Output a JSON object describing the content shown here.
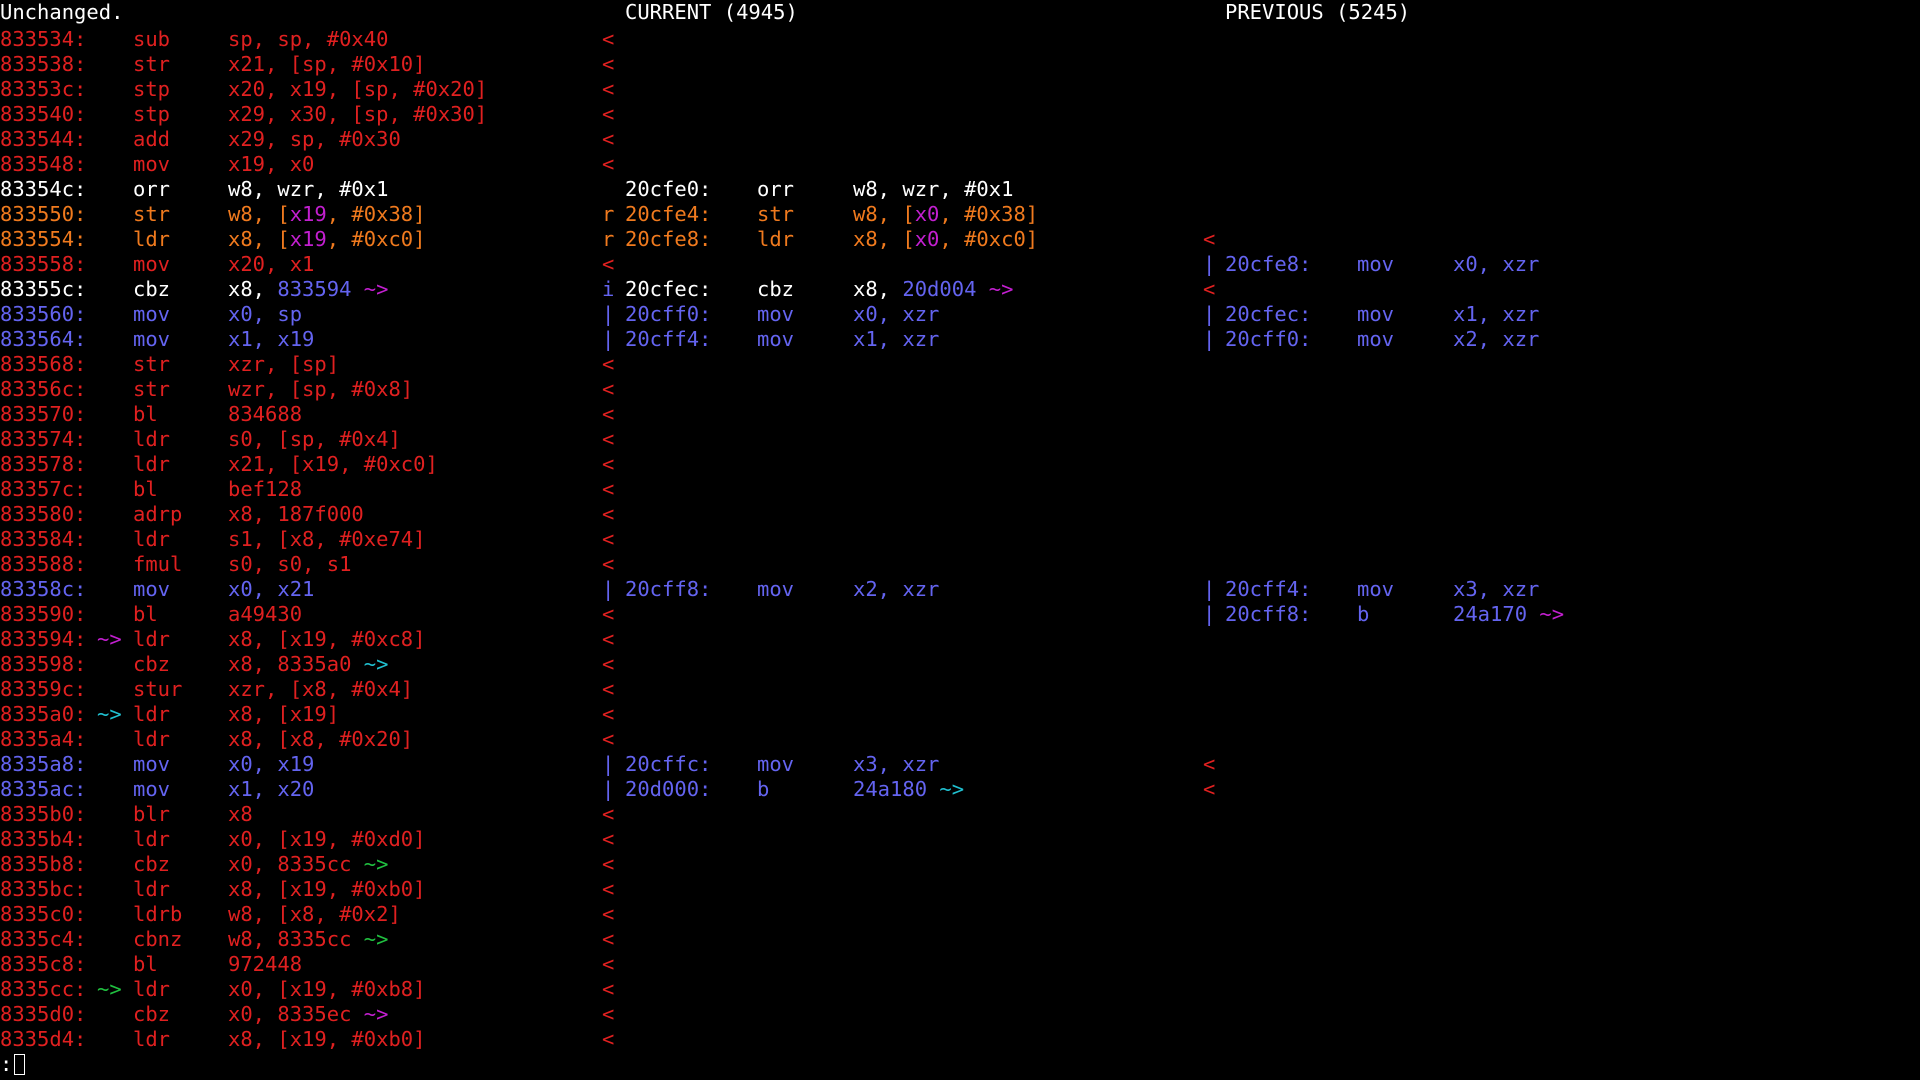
{
  "header": {
    "status": "Unchanged.",
    "current_label": "CURRENT (4945)",
    "previous_label": "PREVIOUS (5245)"
  },
  "prompt": ":",
  "colors": {
    "removed": "#e02020",
    "same": "#ffffff",
    "changed": "#f07a1e",
    "inserted": "#6464f0",
    "register_highlight": "#c31fd0",
    "magenta_arrow": "#c31fd0",
    "cyan_arrow": "#20c0d0",
    "green_arrow": "#20c040"
  },
  "rows": [
    {
      "left": {
        "t": "r",
        "addr": "833534:",
        "op": "sub",
        "args": [
          [
            "sp, sp, #0x40"
          ]
        ]
      },
      "cm": "<"
    },
    {
      "left": {
        "t": "r",
        "addr": "833538:",
        "op": "str",
        "args": [
          [
            "x21, [sp, #0x10]"
          ]
        ]
      },
      "cm": "<"
    },
    {
      "left": {
        "t": "r",
        "addr": "83353c:",
        "op": "stp",
        "args": [
          [
            "x20, x19, [sp, #0x20]"
          ]
        ]
      },
      "cm": "<"
    },
    {
      "left": {
        "t": "r",
        "addr": "833540:",
        "op": "stp",
        "args": [
          [
            "x29, x30, [sp, #0x30]"
          ]
        ]
      },
      "cm": "<"
    },
    {
      "left": {
        "t": "r",
        "addr": "833544:",
        "op": "add",
        "args": [
          [
            "x29, sp, #0x30"
          ]
        ]
      },
      "cm": "<"
    },
    {
      "left": {
        "t": "r",
        "addr": "833548:",
        "op": "mov",
        "args": [
          [
            "x19, x0"
          ]
        ]
      },
      "cm": "<"
    },
    {
      "left": {
        "t": "w",
        "addr": "83354c:",
        "op": "orr",
        "args": [
          [
            "w8, wzr, #0x1"
          ]
        ]
      },
      "cur": {
        "t": "w",
        "addr": "20cfe0:",
        "op": "orr",
        "args": [
          [
            "w8, wzr, #0x1"
          ]
        ]
      }
    },
    {
      "left": {
        "t": "o",
        "addr": "833550:",
        "op": "str",
        "args": [
          [
            "w8, ["
          ],
          [
            "x19",
            "m"
          ],
          [
            ", #0x38]"
          ]
        ]
      },
      "cm": "r",
      "cur": {
        "t": "o",
        "addr": "20cfe4:",
        "op": "str",
        "args": [
          [
            "w8, ["
          ],
          [
            "x0",
            "m"
          ],
          [
            ", #0x38]"
          ]
        ]
      }
    },
    {
      "left": {
        "t": "o",
        "addr": "833554:",
        "op": "ldr",
        "args": [
          [
            "x8, ["
          ],
          [
            "x19",
            "m"
          ],
          [
            ", #0xc0]"
          ]
        ]
      },
      "cm": "r",
      "cur": {
        "t": "o",
        "addr": "20cfe8:",
        "op": "ldr",
        "args": [
          [
            "x8, ["
          ],
          [
            "x0",
            "m"
          ],
          [
            ", #0xc0]"
          ]
        ]
      },
      "pm": "<"
    },
    {
      "left": {
        "t": "r",
        "addr": "833558:",
        "op": "mov",
        "args": [
          [
            "x20, x1"
          ]
        ]
      },
      "cm": "<",
      "prev": {
        "t": "b",
        "addr": "20cfe8:",
        "op": "mov",
        "args": [
          [
            "x0, xzr"
          ]
        ]
      },
      "pm": "|"
    },
    {
      "left": {
        "t": "w",
        "addr": "83355c:",
        "op": "cbz",
        "args": [
          [
            "x8, "
          ],
          [
            "833594",
            "b"
          ],
          [
            " ~>",
            "m"
          ]
        ]
      },
      "cm": "i",
      "cur": {
        "t": "w",
        "addr": "20cfec:",
        "op": "cbz",
        "args": [
          [
            "x8, "
          ],
          [
            "20d004",
            "b"
          ],
          [
            " ~>",
            "m"
          ]
        ]
      },
      "pm": "<"
    },
    {
      "left": {
        "t": "b",
        "addr": "833560:",
        "op": "mov",
        "args": [
          [
            "x0, sp"
          ]
        ]
      },
      "cm": "|",
      "cur": {
        "t": "b",
        "addr": "20cff0:",
        "op": "mov",
        "args": [
          [
            "x0, xzr"
          ]
        ]
      },
      "prev": {
        "t": "b",
        "addr": "20cfec:",
        "op": "mov",
        "args": [
          [
            "x1, xzr"
          ]
        ]
      },
      "pm": "|"
    },
    {
      "left": {
        "t": "b",
        "addr": "833564:",
        "op": "mov",
        "args": [
          [
            "x1, x19"
          ]
        ]
      },
      "cm": "|",
      "cur": {
        "t": "b",
        "addr": "20cff4:",
        "op": "mov",
        "args": [
          [
            "x1, xzr"
          ]
        ]
      },
      "prev": {
        "t": "b",
        "addr": "20cff0:",
        "op": "mov",
        "args": [
          [
            "x2, xzr"
          ]
        ]
      },
      "pm": "|"
    },
    {
      "left": {
        "t": "r",
        "addr": "833568:",
        "op": "str",
        "args": [
          [
            "xzr, [sp]"
          ]
        ]
      },
      "cm": "<"
    },
    {
      "left": {
        "t": "r",
        "addr": "83356c:",
        "op": "str",
        "args": [
          [
            "wzr, [sp, #0x8]"
          ]
        ]
      },
      "cm": "<"
    },
    {
      "left": {
        "t": "r",
        "addr": "833570:",
        "op": "bl",
        "args": [
          [
            "834688"
          ]
        ]
      },
      "cm": "<"
    },
    {
      "left": {
        "t": "r",
        "addr": "833574:",
        "op": "ldr",
        "args": [
          [
            "s0, [sp, #0x4]"
          ]
        ]
      },
      "cm": "<"
    },
    {
      "left": {
        "t": "r",
        "addr": "833578:",
        "op": "ldr",
        "args": [
          [
            "x21, [x19, #0xc0]"
          ]
        ]
      },
      "cm": "<"
    },
    {
      "left": {
        "t": "r",
        "addr": "83357c:",
        "op": "bl",
        "args": [
          [
            "bef128"
          ]
        ]
      },
      "cm": "<"
    },
    {
      "left": {
        "t": "r",
        "addr": "833580:",
        "op": "adrp",
        "args": [
          [
            "x8, 187f000"
          ]
        ]
      },
      "cm": "<"
    },
    {
      "left": {
        "t": "r",
        "addr": "833584:",
        "op": "ldr",
        "args": [
          [
            "s1, [x8, #0xe74]"
          ]
        ]
      },
      "cm": "<"
    },
    {
      "left": {
        "t": "r",
        "addr": "833588:",
        "op": "fmul",
        "args": [
          [
            "s0, s0, s1"
          ]
        ]
      },
      "cm": "<"
    },
    {
      "left": {
        "t": "b",
        "addr": "83358c:",
        "op": "mov",
        "args": [
          [
            "x0, x21"
          ]
        ]
      },
      "cm": "|",
      "cur": {
        "t": "b",
        "addr": "20cff8:",
        "op": "mov",
        "args": [
          [
            "x2, xzr"
          ]
        ]
      },
      "prev": {
        "t": "b",
        "addr": "20cff4:",
        "op": "mov",
        "args": [
          [
            "x3, xzr"
          ]
        ]
      },
      "pm": "|"
    },
    {
      "left": {
        "t": "r",
        "addr": "833590:",
        "op": "bl",
        "args": [
          [
            "a49430"
          ]
        ]
      },
      "cm": "<",
      "prev": {
        "t": "b",
        "addr": "20cff8:",
        "op": "b",
        "args": [
          [
            "24a170"
          ],
          [
            " ~>",
            "m"
          ]
        ]
      },
      "pm": "|"
    },
    {
      "left": {
        "t": "r",
        "addr": "833594:",
        "arrow": [
          "~>",
          "m"
        ],
        "op": "ldr",
        "args": [
          [
            "x8, [x19, #0xc8]"
          ]
        ]
      },
      "cm": "<"
    },
    {
      "left": {
        "t": "r",
        "addr": "833598:",
        "op": "cbz",
        "args": [
          [
            "x8, 8335a0"
          ],
          [
            " ~>",
            "c"
          ]
        ]
      },
      "cm": "<"
    },
    {
      "left": {
        "t": "r",
        "addr": "83359c:",
        "op": "stur",
        "args": [
          [
            "xzr, [x8, #0x4]"
          ]
        ]
      },
      "cm": "<"
    },
    {
      "left": {
        "t": "r",
        "addr": "8335a0:",
        "arrow": [
          "~>",
          "c"
        ],
        "op": "ldr",
        "args": [
          [
            "x8, [x19]"
          ]
        ]
      },
      "cm": "<"
    },
    {
      "left": {
        "t": "r",
        "addr": "8335a4:",
        "op": "ldr",
        "args": [
          [
            "x8, [x8, #0x20]"
          ]
        ]
      },
      "cm": "<"
    },
    {
      "left": {
        "t": "b",
        "addr": "8335a8:",
        "op": "mov",
        "args": [
          [
            "x0, x19"
          ]
        ]
      },
      "cm": "|",
      "cur": {
        "t": "b",
        "addr": "20cffc:",
        "op": "mov",
        "args": [
          [
            "x3, xzr"
          ]
        ]
      },
      "pm": "<"
    },
    {
      "left": {
        "t": "b",
        "addr": "8335ac:",
        "op": "mov",
        "args": [
          [
            "x1, x20"
          ]
        ]
      },
      "cm": "|",
      "cur": {
        "t": "b",
        "addr": "20d000:",
        "op": "b",
        "args": [
          [
            "24a180"
          ],
          [
            " ~>",
            "c"
          ]
        ]
      },
      "pm": "<"
    },
    {
      "left": {
        "t": "r",
        "addr": "8335b0:",
        "op": "blr",
        "args": [
          [
            "x8"
          ]
        ]
      },
      "cm": "<"
    },
    {
      "left": {
        "t": "r",
        "addr": "8335b4:",
        "op": "ldr",
        "args": [
          [
            "x0, [x19, #0xd0]"
          ]
        ]
      },
      "cm": "<"
    },
    {
      "left": {
        "t": "r",
        "addr": "8335b8:",
        "op": "cbz",
        "args": [
          [
            "x0, 8335cc"
          ],
          [
            " ~>",
            "g"
          ]
        ]
      },
      "cm": "<"
    },
    {
      "left": {
        "t": "r",
        "addr": "8335bc:",
        "op": "ldr",
        "args": [
          [
            "x8, [x19, #0xb0]"
          ]
        ]
      },
      "cm": "<"
    },
    {
      "left": {
        "t": "r",
        "addr": "8335c0:",
        "op": "ldrb",
        "args": [
          [
            "w8, [x8, #0x2]"
          ]
        ]
      },
      "cm": "<"
    },
    {
      "left": {
        "t": "r",
        "addr": "8335c4:",
        "op": "cbnz",
        "args": [
          [
            "w8, 8335cc"
          ],
          [
            " ~>",
            "g"
          ]
        ]
      },
      "cm": "<"
    },
    {
      "left": {
        "t": "r",
        "addr": "8335c8:",
        "op": "bl",
        "args": [
          [
            "972448"
          ]
        ]
      },
      "cm": "<"
    },
    {
      "left": {
        "t": "r",
        "addr": "8335cc:",
        "arrow": [
          "~>",
          "g"
        ],
        "op": "ldr",
        "args": [
          [
            "x0, [x19, #0xb8]"
          ]
        ]
      },
      "cm": "<"
    },
    {
      "left": {
        "t": "r",
        "addr": "8335d0:",
        "op": "cbz",
        "args": [
          [
            "x0, 8335ec"
          ],
          [
            " ~>",
            "m"
          ]
        ]
      },
      "cm": "<"
    },
    {
      "left": {
        "t": "r",
        "addr": "8335d4:",
        "op": "ldr",
        "args": [
          [
            "x8, [x19, #0xb0]"
          ]
        ]
      },
      "cm": "<"
    }
  ]
}
